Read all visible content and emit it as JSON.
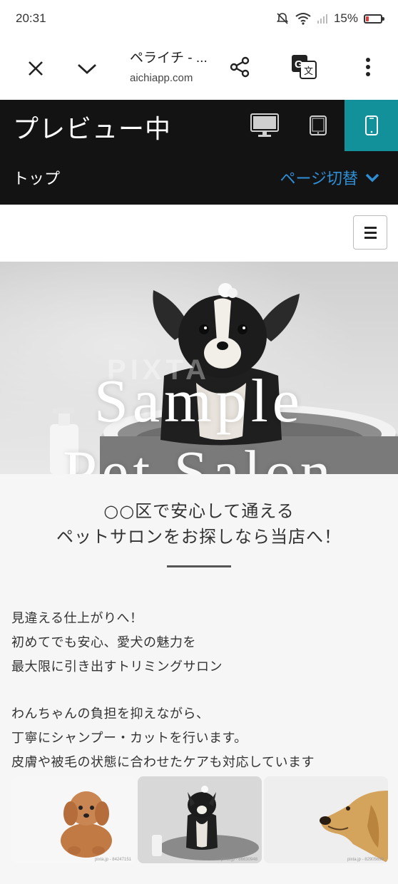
{
  "status": {
    "time": "20:31",
    "battery": "15%"
  },
  "browser": {
    "page_title": "ペライチ - ...",
    "url": "aichiapp.com"
  },
  "preview": {
    "title": "プレビュー中",
    "current_page": "トップ",
    "switch_label": "ページ切替"
  },
  "hero": {
    "line1": "Sample",
    "line2": "Pet Salon",
    "watermark": "PIXTA"
  },
  "content": {
    "headline_line1": "○○区で安心して通える",
    "headline_line2": "ペットサロンをお探しなら当店へ！",
    "para1_line1": "見違える仕上がりへ！",
    "para1_line2": "初めてでも安心、愛犬の魅力を",
    "para1_line3": "最大限に引き出すトリミングサロン",
    "para2_line1": "わんちゃんの負担を抑えながら、",
    "para2_line2": "丁寧にシャンプー・カットを行います。",
    "para2_line3": "皮膚や被毛の状態に合わせたケアも対応しています"
  },
  "gallery": [
    {
      "caption": "pixta.jp - 84247151"
    },
    {
      "caption": "pixta.jp - 86630948"
    },
    {
      "caption": "pixta.jp - 82905698"
    }
  ]
}
